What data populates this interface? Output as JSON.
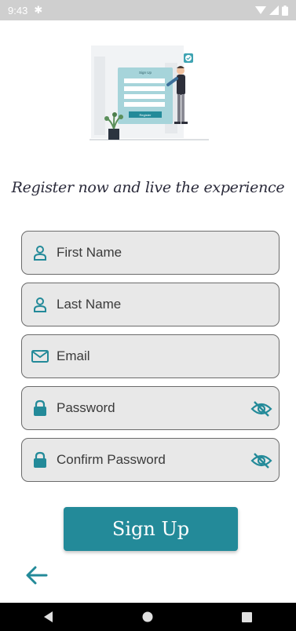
{
  "status_bar": {
    "time": "9:43"
  },
  "headline": "Register now and live the experience",
  "illustration": {
    "form_title": "Sign Up",
    "button_label": "Register"
  },
  "form": {
    "first_name": {
      "placeholder": "First Name"
    },
    "last_name": {
      "placeholder": "Last Name"
    },
    "email": {
      "placeholder": "Email"
    },
    "password": {
      "placeholder": "Password"
    },
    "confirm_password": {
      "placeholder": "Confirm Password"
    }
  },
  "signup_button": {
    "label": "Sign Up"
  },
  "colors": {
    "accent": "#238a99",
    "field_bg": "#e8e8e8"
  }
}
